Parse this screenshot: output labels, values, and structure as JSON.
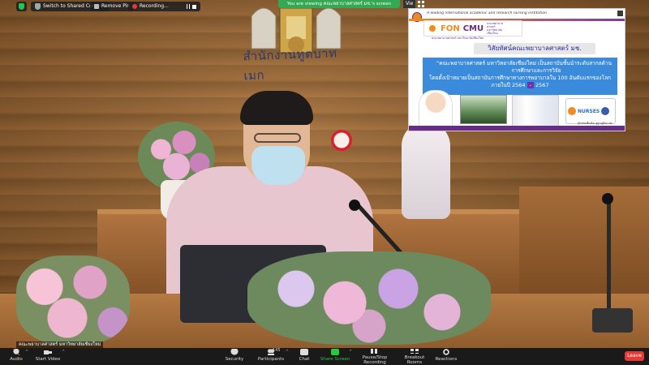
{
  "topbar": {
    "switch_label": "Switch to Shared Content",
    "remove_pin_label": "Remove Pin",
    "recording_label": "Recording...",
    "viewing_banner": "You are viewing คณะพยาบาลศาสตร์ มช.'s screen",
    "view_label": "Vie"
  },
  "room": {
    "emblem_text": "สำนักงานทูตบาทเมก"
  },
  "shared_slide": {
    "tagline": "A leading international academic and research nursing institution",
    "logo_fon": "FON",
    "logo_cmu": "CMU",
    "logo_mini": "คณะพยาบาลศาสตร์ มหาวิทยาลัยเชียงใหม่",
    "subtitle": "คณะพยาบาลศาสตร์ มหาวิทยาลัยเชียงใหม่",
    "header": "วิสัยทัศน์คณะพยาบาลศาสตร์ มช.",
    "vision_line1": "“คณะพยาบาลศาสตร์ มหาวิทยาลัยเชียงใหม่ เป็นสถาบันชั้นนำระดับสากลด้าน",
    "vision_line2": "การศึกษาและการวิจัย",
    "vision_line3_pre": "โดยตั้งเป้าหมายเป็นสถาบันการศึกษาทางการพยาบาลใน 100 อันดับแรกของโลก",
    "vision_line4_pre": "ภายในปี 2564",
    "vision_line4_hi": "-",
    "vision_line4_post": "2567",
    "nurses_label": "NURSES",
    "small_text": "รู้รักษ์ชนพื้นเมือง สู่ลูกอยู่ดีอนามัย"
  },
  "participant_name": "คณะพยาบาลศาสตร์ มหาวิทยาลัยเชียงใหม่",
  "toolbar": {
    "audio": "Audio",
    "start_video": "Start Video",
    "security": "Security",
    "participants": "Participants",
    "participants_count": "145",
    "chat": "Chat",
    "share_screen": "Share Screen",
    "pause_recording": "Pause/Stop Recording",
    "breakout_rooms": "Breakout Rooms",
    "reactions": "Reactions",
    "leave": "Leave"
  }
}
